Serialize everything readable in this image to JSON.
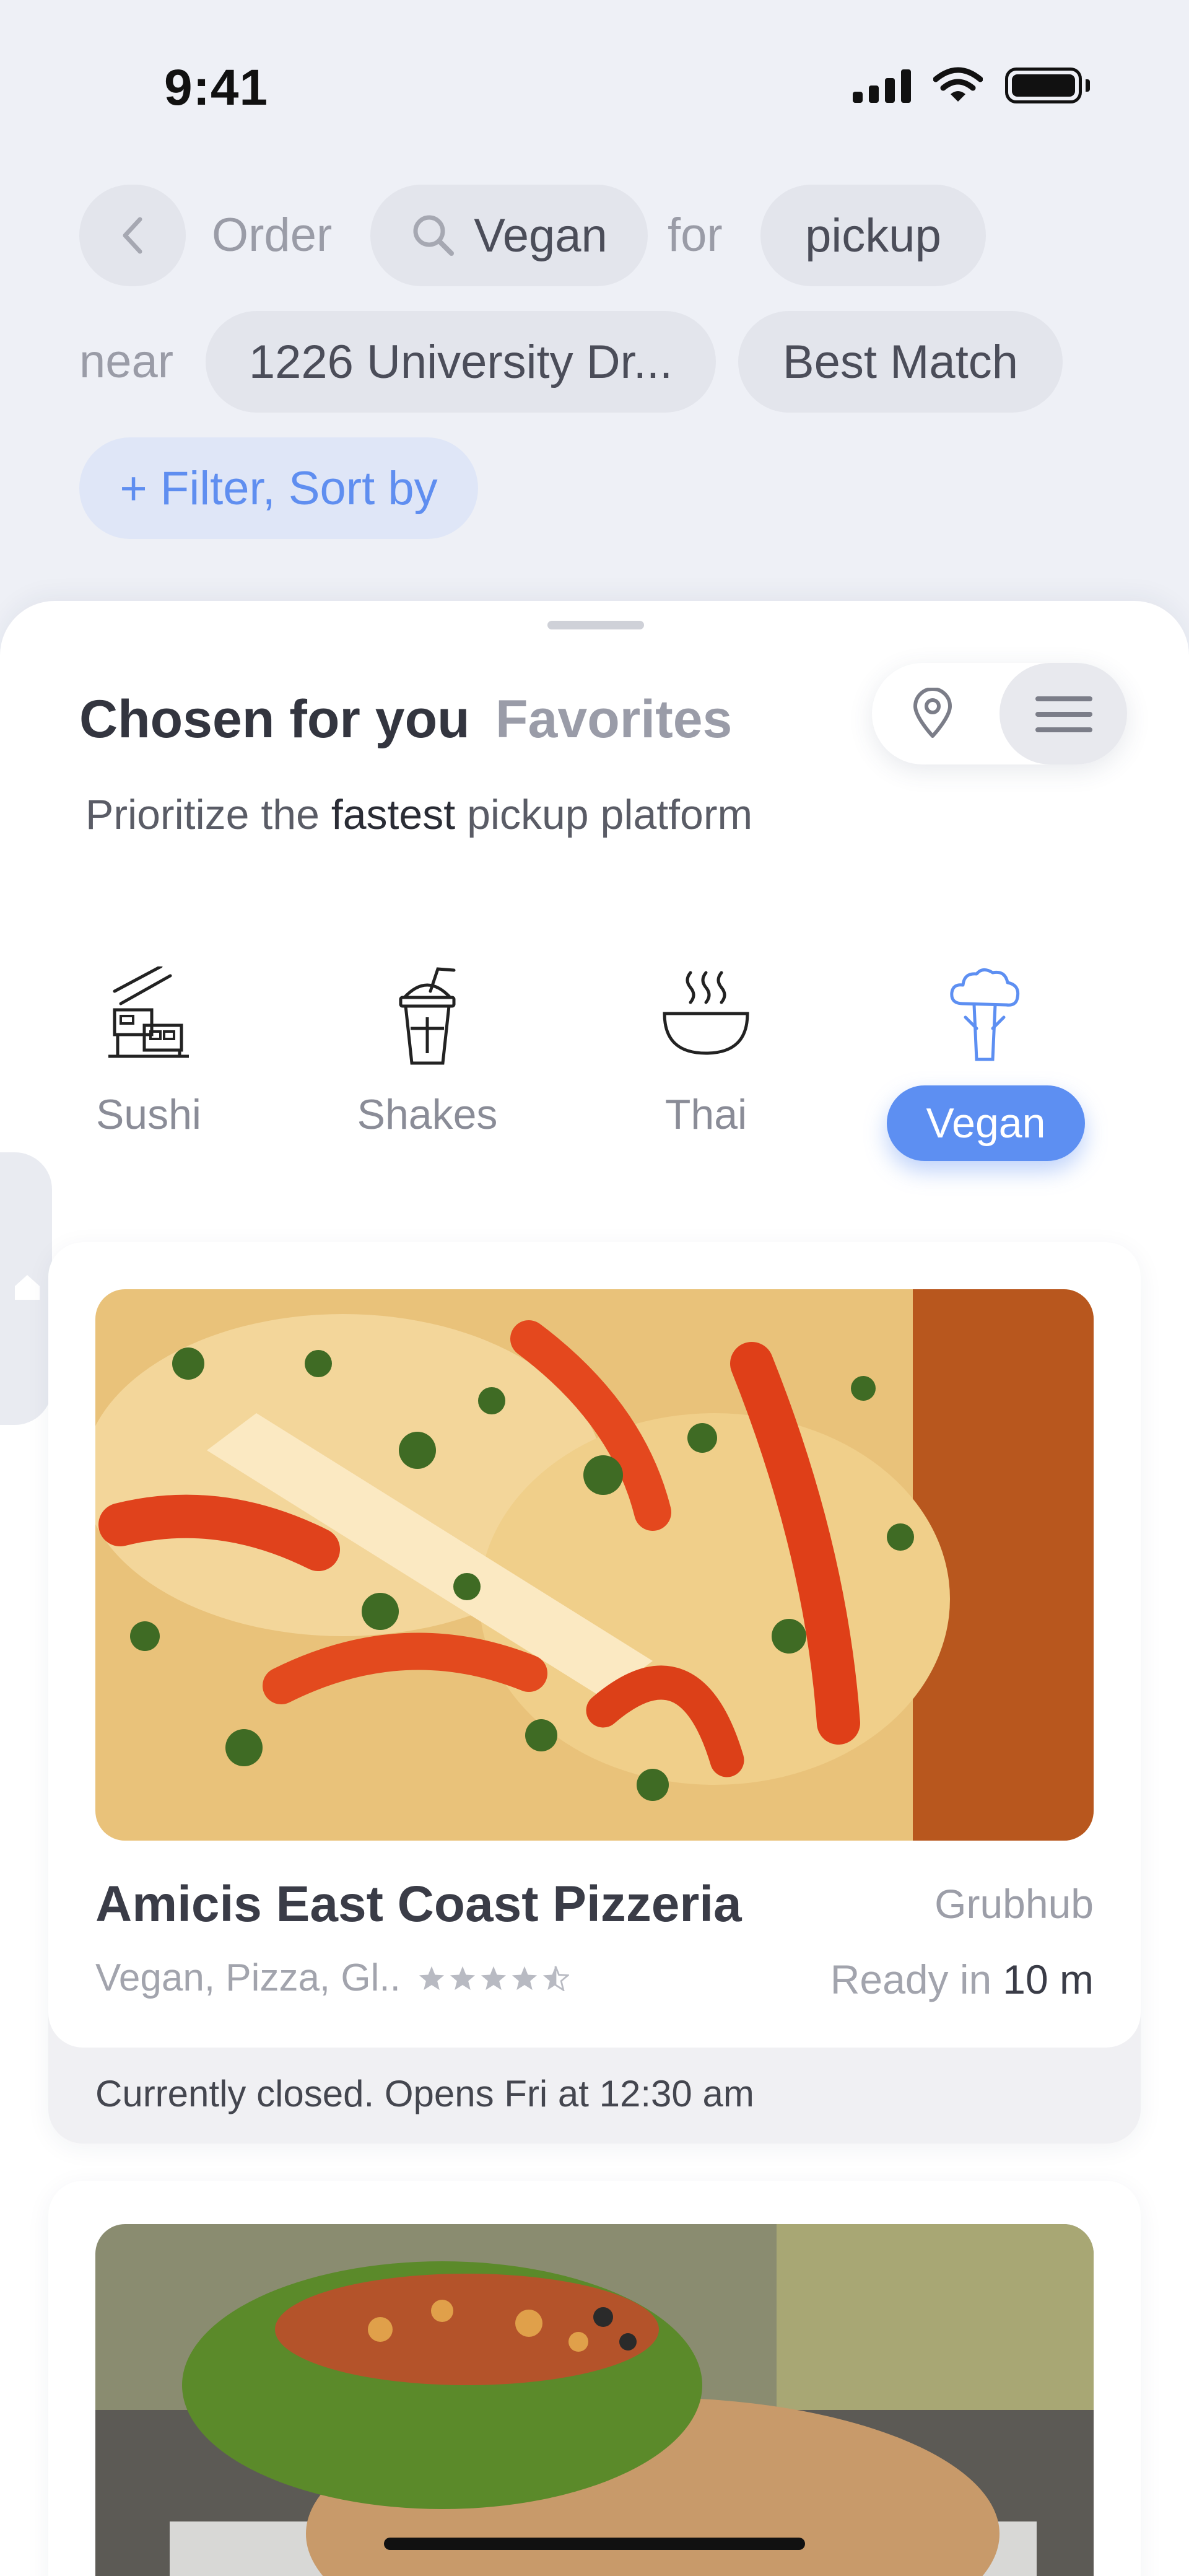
{
  "status_bar": {
    "time": "9:41"
  },
  "search_bar": {
    "order_label": "Order",
    "search_term": "Vegan",
    "for_label": "for",
    "mode": "pickup",
    "near_label": "near",
    "address": "1226 University Dr...",
    "sort": "Best Match",
    "filter_label": "+ Filter, Sort by"
  },
  "tabs": {
    "chosen": "Chosen for you",
    "favorites": "Favorites"
  },
  "subtitle": {
    "prefix": "Prioritize the",
    "emphasis": "fastest",
    "suffix": "pickup platform"
  },
  "categories": [
    {
      "label": "Sushi",
      "icon": "sushi-icon",
      "selected": false
    },
    {
      "label": "Shakes",
      "icon": "shake-icon",
      "selected": false
    },
    {
      "label": "Thai",
      "icon": "noodle-bowl-icon",
      "selected": false
    },
    {
      "label": "Vegan",
      "icon": "broccoli-icon",
      "selected": true
    }
  ],
  "restaurants": [
    {
      "name": "Amicis East Coast Pizzeria",
      "platform": "Grubhub",
      "tags": "Vegan, Pizza, Gl..",
      "rating": 4.5,
      "ready_label": "Ready in",
      "ready_value": "10 m",
      "status": "Currently closed. Opens Fri at 12:30 am"
    }
  ],
  "colors": {
    "accent": "#5d8ff2",
    "background": "#eef0f6",
    "card": "#ffffff"
  }
}
